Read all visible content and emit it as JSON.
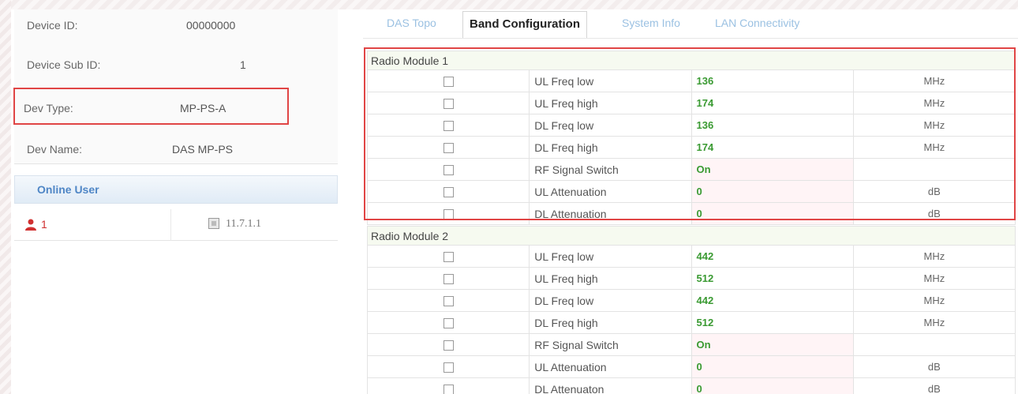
{
  "device": {
    "id_label": "Device ID:",
    "id_value": "00000000",
    "sub_id_label": "Device Sub ID:",
    "sub_id_value": "1",
    "type_label": "Dev Type:",
    "type_value": "MP-PS-A",
    "name_label": "Dev Name:",
    "name_value": "DAS MP-PS"
  },
  "online_user": {
    "title": "Online User",
    "count": "1",
    "ip": "11.7.1.1"
  },
  "tabs": [
    "DAS Topo",
    "Band Configuration",
    "System Info",
    "LAN Connectivity"
  ],
  "active_tab": "Band Configuration",
  "modules": [
    {
      "title": "Radio Module 1",
      "rows": [
        {
          "name": "UL Freq low",
          "value": "136",
          "unit": "MHz"
        },
        {
          "name": "UL Freq high",
          "value": "174",
          "unit": "MHz"
        },
        {
          "name": "DL Freq low",
          "value": "136",
          "unit": "MHz"
        },
        {
          "name": "DL Freq high",
          "value": "174",
          "unit": "MHz"
        },
        {
          "name": "RF Signal Switch",
          "value": "On",
          "unit": ""
        },
        {
          "name": "UL Attenuation",
          "value": "0",
          "unit": "dB"
        },
        {
          "name": "DL Attenuation",
          "value": "0",
          "unit": "dB"
        }
      ]
    },
    {
      "title": "Radio Module 2",
      "rows": [
        {
          "name": "UL Freq low",
          "value": "442",
          "unit": "MHz"
        },
        {
          "name": "UL Freq high",
          "value": "512",
          "unit": "MHz"
        },
        {
          "name": "DL Freq low",
          "value": "442",
          "unit": "MHz"
        },
        {
          "name": "DL Freq high",
          "value": "512",
          "unit": "MHz"
        },
        {
          "name": "RF Signal Switch",
          "value": "On",
          "unit": ""
        },
        {
          "name": "UL Attenuation",
          "value": "0",
          "unit": "dB"
        },
        {
          "name": "DL Attenuaton",
          "value": "0",
          "unit": "dB"
        }
      ]
    }
  ],
  "colors": {
    "highlight": "#e04545",
    "value_green": "#3a9a32",
    "tab_inactive": "#9bc1e2",
    "online_header": "#4f86c6",
    "user_red": "#d03030"
  }
}
